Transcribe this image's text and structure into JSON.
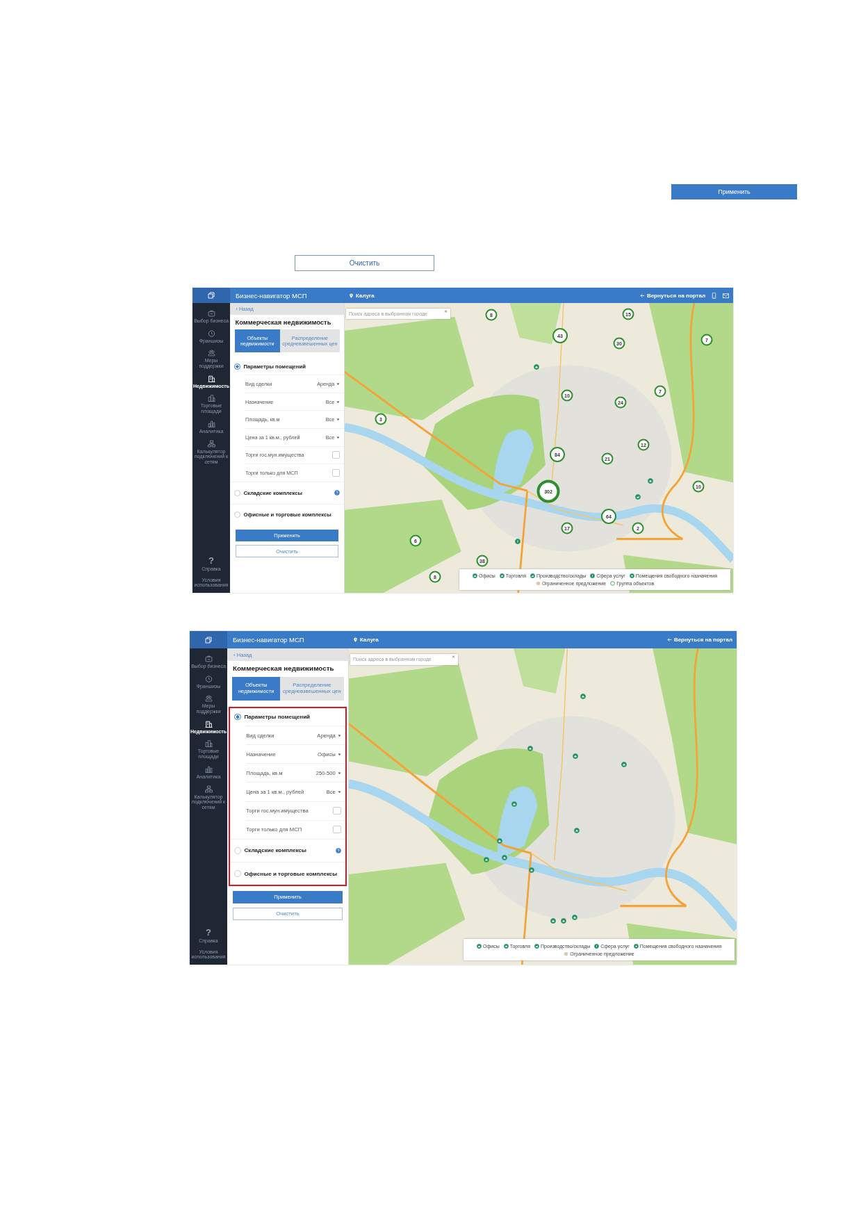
{
  "page_buttons": [
    {
      "kind": "primary",
      "label": "Применить"
    },
    {
      "kind": "secondary",
      "label": "Очистить"
    }
  ],
  "screenshots": [
    {
      "header": {
        "title": "Бизнес-навигатор МСП",
        "city": "Калуга",
        "portal_link": "Вернуться на портал",
        "contact_icons": true
      },
      "nav": [
        {
          "label": "Выбор бизнеса",
          "selected": false
        },
        {
          "label": "Франшизы",
          "selected": false
        },
        {
          "label": "Меры поддержки",
          "selected": false
        },
        {
          "label": "Недвижимость",
          "selected": true
        },
        {
          "label": "Торговые площади",
          "selected": false
        },
        {
          "label": "Аналитика",
          "selected": false
        },
        {
          "label": "Калькулятор подключений к сетям",
          "selected": false
        }
      ],
      "nav_bottom": [
        {
          "icon_char": "?",
          "label": "Справка"
        },
        {
          "label": "Условия использования"
        }
      ],
      "panel": {
        "back": "‹ Назад",
        "title": "Коммерческая недвижимость",
        "tabs": [
          {
            "label": "Объекты недвижимости",
            "selected": true
          },
          {
            "label": "Распределение средневзвешенных цен",
            "selected": false
          }
        ],
        "sections": [
          {
            "label": "Параметры помещений",
            "selected": true,
            "fields": [
              {
                "kind": "select",
                "label": "Вид сделки",
                "value": "Аренда"
              },
              {
                "kind": "select",
                "label": "Назначение",
                "value": "Все"
              },
              {
                "kind": "select",
                "label": "Площадь, кв.м",
                "value": "Все"
              },
              {
                "kind": "select",
                "label": "Цена за 1 кв.м., рублей",
                "value": "Все"
              },
              {
                "kind": "checkbox",
                "label": "Торги гос.мун.имущества",
                "checked": false
              },
              {
                "kind": "checkbox",
                "label": "Торги только для МСП",
                "checked": false
              }
            ]
          },
          {
            "label": "Складские комплексы",
            "selected": false,
            "help": true
          },
          {
            "label": "Офисные и торговые комплексы",
            "selected": false
          }
        ],
        "buttons": [
          {
            "kind": "primary",
            "label": "Применить"
          },
          {
            "kind": "secondary",
            "label": "Очистить"
          }
        ]
      },
      "map": {
        "search_placeholder": "Поиск адреса в выбранном городе",
        "markers": [
          {
            "kind": "cluster",
            "count": "8"
          },
          {
            "kind": "cluster",
            "count": "15"
          },
          {
            "kind": "cluster",
            "count": "43"
          },
          {
            "kind": "cluster",
            "count": "30"
          },
          {
            "kind": "cluster",
            "count": "7"
          },
          {
            "kind": "cluster",
            "count": "10"
          },
          {
            "kind": "cluster",
            "count": "24"
          },
          {
            "kind": "cluster",
            "count": "7"
          },
          {
            "kind": "cluster",
            "count": "3"
          },
          {
            "kind": "cluster",
            "count": "12"
          },
          {
            "kind": "cluster",
            "count": "84"
          },
          {
            "kind": "cluster",
            "count": "21"
          },
          {
            "kind": "cluster",
            "count": "302"
          },
          {
            "kind": "cluster",
            "count": "64"
          },
          {
            "kind": "cluster",
            "count": "17"
          },
          {
            "kind": "cluster",
            "count": "2"
          },
          {
            "kind": "cluster",
            "count": "10"
          },
          {
            "kind": "cluster",
            "count": "6"
          },
          {
            "kind": "cluster",
            "count": "38"
          },
          {
            "kind": "cluster",
            "count": "8"
          },
          {
            "kind": "office"
          },
          {
            "kind": "office"
          },
          {
            "kind": "production"
          },
          {
            "kind": "services"
          }
        ],
        "legend": [
          {
            "kind": "office",
            "label": "Офисы"
          },
          {
            "kind": "trade",
            "label": "Торговля"
          },
          {
            "kind": "production",
            "label": "Производство/склады"
          },
          {
            "kind": "services",
            "label": "Сфера услуг"
          },
          {
            "kind": "free",
            "label": "Помещения свободного назначения"
          },
          {
            "kind": "limited",
            "label": "Ограниченное предложение"
          },
          {
            "kind": "group",
            "label": "Группа объектов"
          }
        ]
      }
    },
    {
      "header": {
        "title": "Бизнес-навигатор МСП",
        "city": "Калуга",
        "portal_link": "Вернуться на портал"
      },
      "nav": [
        {
          "label": "Выбор бизнеса",
          "selected": false
        },
        {
          "label": "Франшизы",
          "selected": false
        },
        {
          "label": "Меры поддержки",
          "selected": false
        },
        {
          "label": "Недвижимость",
          "selected": true
        },
        {
          "label": "Торговые площади",
          "selected": false
        },
        {
          "label": "Аналитика",
          "selected": false
        },
        {
          "label": "Калькулятор подключений к сетям",
          "selected": false
        }
      ],
      "nav_bottom": [
        {
          "icon_char": "?",
          "label": "Справка"
        },
        {
          "label": "Условия использования"
        }
      ],
      "panel": {
        "back": "‹ Назад",
        "title": "Коммерческая недвижимость",
        "highlighted": true,
        "tabs": [
          {
            "label": "Объекты недвижимости",
            "selected": true
          },
          {
            "label": "Распределение средневзвешенных цен",
            "selected": false
          }
        ],
        "sections": [
          {
            "label": "Параметры помещений",
            "selected": true,
            "fields": [
              {
                "kind": "select",
                "label": "Вид сделки",
                "value": "Аренда"
              },
              {
                "kind": "select",
                "label": "Назначение",
                "value": "Офисы"
              },
              {
                "kind": "select",
                "label": "Площадь, кв.м",
                "value": "250-500"
              },
              {
                "kind": "select",
                "label": "Цена за 1 кв.м., рублей",
                "value": "Все"
              },
              {
                "kind": "checkbox",
                "label": "Торги гос.мун.имущества",
                "checked": false
              },
              {
                "kind": "checkbox",
                "label": "Торги только для МСП",
                "checked": false
              }
            ]
          },
          {
            "label": "Складские комплексы",
            "selected": false,
            "help": true
          },
          {
            "label": "Офисные и торговые комплексы",
            "selected": false
          }
        ],
        "buttons": [
          {
            "kind": "primary",
            "label": "Применить"
          },
          {
            "kind": "secondary",
            "label": "Очистить"
          }
        ]
      },
      "map": {
        "search_placeholder": "Поиск адреса в выбранном городе",
        "markers": [
          {
            "kind": "office"
          },
          {
            "kind": "office"
          },
          {
            "kind": "office"
          },
          {
            "kind": "office"
          },
          {
            "kind": "office"
          },
          {
            "kind": "office"
          },
          {
            "kind": "office"
          },
          {
            "kind": "office"
          },
          {
            "kind": "office"
          },
          {
            "kind": "office"
          },
          {
            "kind": "office"
          },
          {
            "kind": "office"
          },
          {
            "kind": "office"
          }
        ],
        "legend": [
          {
            "kind": "office",
            "label": "Офисы"
          },
          {
            "kind": "trade",
            "label": "Торговля"
          },
          {
            "kind": "production",
            "label": "Производство/склады"
          },
          {
            "kind": "services",
            "label": "Сфера услуг"
          },
          {
            "kind": "free",
            "label": "Помещения свободного назначения"
          },
          {
            "kind": "limited",
            "label": "Ограниченное предложение"
          }
        ]
      }
    }
  ]
}
